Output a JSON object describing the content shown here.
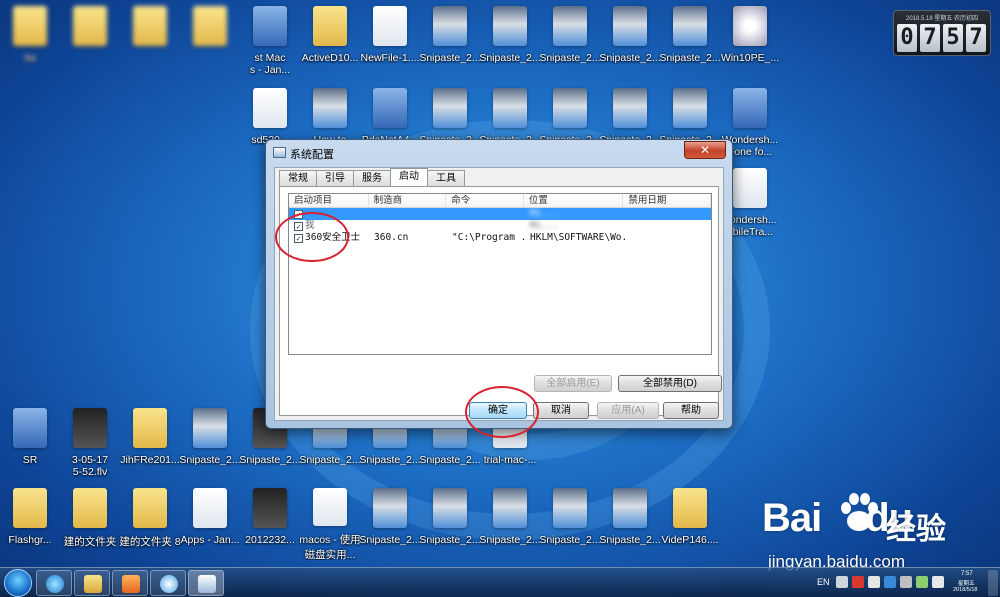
{
  "desktop": {
    "icons_top_row": [
      {
        "label": "tia",
        "kind": "folder",
        "blur": true
      },
      {
        "label": "",
        "kind": "folder",
        "blur": true
      },
      {
        "label": "",
        "kind": "folder",
        "blur": true
      },
      {
        "label": "",
        "kind": "folder",
        "blur": true
      },
      {
        "label": "st Mac\ns - Jan...",
        "kind": "app",
        "blur": false
      },
      {
        "label": "ActiveD10...",
        "kind": "folder",
        "blur": false
      },
      {
        "label": "NewFile-1....",
        "kind": "doc",
        "blur": false
      },
      {
        "label": "Snipaste_2...",
        "kind": "shot",
        "blur": false
      },
      {
        "label": "Snipaste_2...",
        "kind": "shot",
        "blur": false
      },
      {
        "label": "Snipaste_2...",
        "kind": "shot",
        "blur": false
      },
      {
        "label": "Snipaste_2...",
        "kind": "shot",
        "blur": false
      },
      {
        "label": "Snipaste_2...",
        "kind": "shot",
        "blur": false
      },
      {
        "label": "Win10PE_...",
        "kind": "disc",
        "blur": false
      }
    ],
    "icons_second_row": [
      {
        "label": "sd539...",
        "kind": "doc"
      },
      {
        "label": "How to",
        "kind": "shot"
      },
      {
        "label": "PdaNetA4...",
        "kind": "app"
      },
      {
        "label": "Snipaste_2...",
        "kind": "shot"
      },
      {
        "label": "Snipaste_2...",
        "kind": "shot"
      },
      {
        "label": "Snipaste_2...",
        "kind": "shot"
      },
      {
        "label": "Snipaste_2...",
        "kind": "shot"
      },
      {
        "label": "Snipaste_2...",
        "kind": "shot"
      },
      {
        "label": "Wondersh...\nFone fo...",
        "kind": "app"
      }
    ],
    "icons_right_col": [
      {
        "label": "Vondersh...\nobileTra...",
        "kind": "doc"
      }
    ],
    "icons_row5": [
      {
        "label": "SR",
        "kind": "app"
      },
      {
        "label": "3-05-17\n5-52.flv",
        "kind": "dark"
      },
      {
        "label": "JihFRe201...",
        "kind": "folder"
      },
      {
        "label": "Snipaste_2...",
        "kind": "shot"
      },
      {
        "label": "Snipaste_2...",
        "kind": "dark"
      },
      {
        "label": "Snipaste_2...",
        "kind": "shot"
      },
      {
        "label": "Snipaste_2...",
        "kind": "shot"
      },
      {
        "label": "Snipaste_2...",
        "kind": "shot"
      },
      {
        "label": "trial-mac-...",
        "kind": "doc"
      }
    ],
    "icons_bottom_row": [
      {
        "label": "Flashgr...",
        "kind": "folder"
      },
      {
        "label": "建的文件夹",
        "kind": "folder"
      },
      {
        "label": "建的文件夹 8",
        "kind": "folder"
      },
      {
        "label": "Apps - Jan...",
        "kind": "doc"
      },
      {
        "label": "2012232...",
        "kind": "dark"
      },
      {
        "label": "macos - 使用\n磁盘实用...",
        "kind": "doc"
      },
      {
        "label": "Snipaste_2...",
        "kind": "shot"
      },
      {
        "label": "Snipaste_2...",
        "kind": "shot"
      },
      {
        "label": "Snipaste_2...",
        "kind": "shot"
      },
      {
        "label": "Snipaste_2...",
        "kind": "shot"
      },
      {
        "label": "Snipaste_2...",
        "kind": "shot"
      },
      {
        "label": "VideP146....",
        "kind": "folder"
      }
    ]
  },
  "clock_gadget": {
    "top_text": "2018.5.18  星期五  农历初四",
    "digits": [
      "0",
      "7",
      "5",
      "7"
    ]
  },
  "dialog": {
    "title": "系统配置",
    "close_label": "✕",
    "tabs": [
      "常规",
      "引导",
      "服务",
      "启动",
      "工具"
    ],
    "active_tab": "启动",
    "columns": [
      "启动项目",
      "制造商",
      "命令",
      "位置",
      "禁用日期"
    ],
    "rows": [
      {
        "checked": true,
        "item": "",
        "maker": "",
        "command": "",
        "location": "Mi...",
        "state": "selected"
      },
      {
        "checked": true,
        "item": "我",
        "maker": "",
        "command": "",
        "location": "Mi...",
        "state": "blurred"
      },
      {
        "checked": true,
        "item": "360安全卫士",
        "maker": "360.cn",
        "command": "\"C:\\Program ...",
        "location": "HKLM\\SOFTWARE\\Wo...",
        "state": "normal"
      }
    ],
    "buttons": {
      "enable_all": "全部启用(E)",
      "disable_all": "全部禁用(D)",
      "ok": "确定",
      "cancel": "取消",
      "apply": "应用(A)",
      "help": "帮助"
    }
  },
  "taskbar": {
    "language": "EN",
    "time": "7:57",
    "date": "2018/5/18",
    "weekday": "星期五"
  },
  "watermark": {
    "brand": "Bai",
    "brand2": "du",
    "cn": "经验",
    "url": "jingyan.baidu.com"
  },
  "colors": {
    "annotation": "#d8222f",
    "selection": "#3399ff"
  }
}
